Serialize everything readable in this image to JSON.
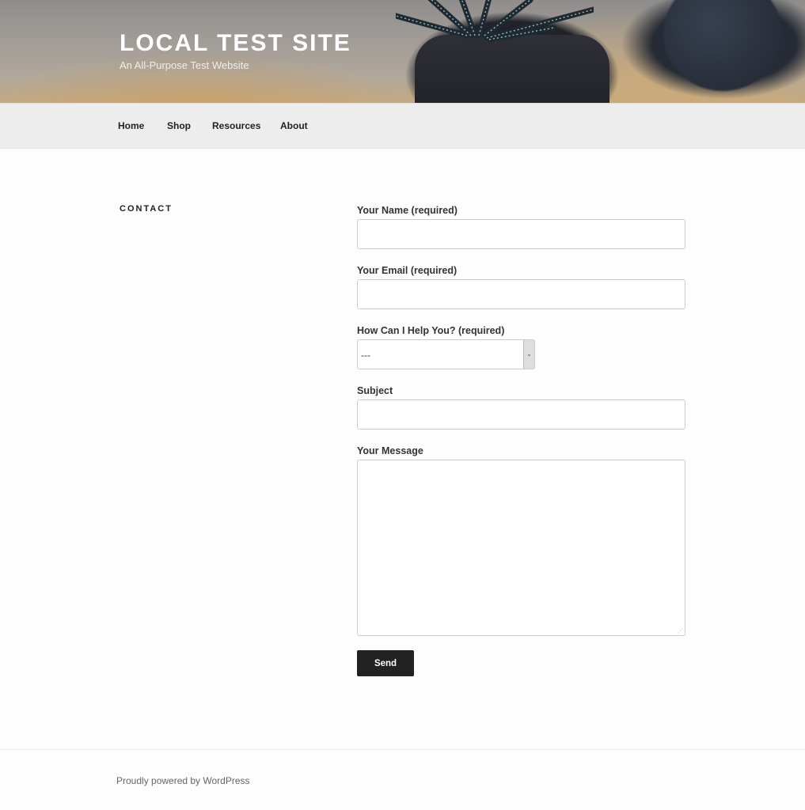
{
  "site": {
    "title": "LOCAL TEST SITE",
    "tagline": "An All-Purpose Test Website"
  },
  "nav": {
    "items": [
      {
        "label": "Home"
      },
      {
        "label": "Shop"
      },
      {
        "label": "Resources"
      },
      {
        "label": "About"
      }
    ]
  },
  "page": {
    "title": "CONTACT"
  },
  "form": {
    "name": {
      "label": "Your Name (required)",
      "value": ""
    },
    "email": {
      "label": "Your Email (required)",
      "value": ""
    },
    "help": {
      "label": "How Can I Help You? (required)",
      "selected": "---",
      "arrow_icon": "chevron-down"
    },
    "subject": {
      "label": "Subject",
      "value": ""
    },
    "message": {
      "label": "Your Message",
      "value": ""
    },
    "submit_label": "Send"
  },
  "footer": {
    "credit": "Proudly powered by WordPress"
  },
  "colors": {
    "button_bg": "#222222",
    "nav_bg": "#ededed",
    "page_bg": "#fdfdfd"
  }
}
